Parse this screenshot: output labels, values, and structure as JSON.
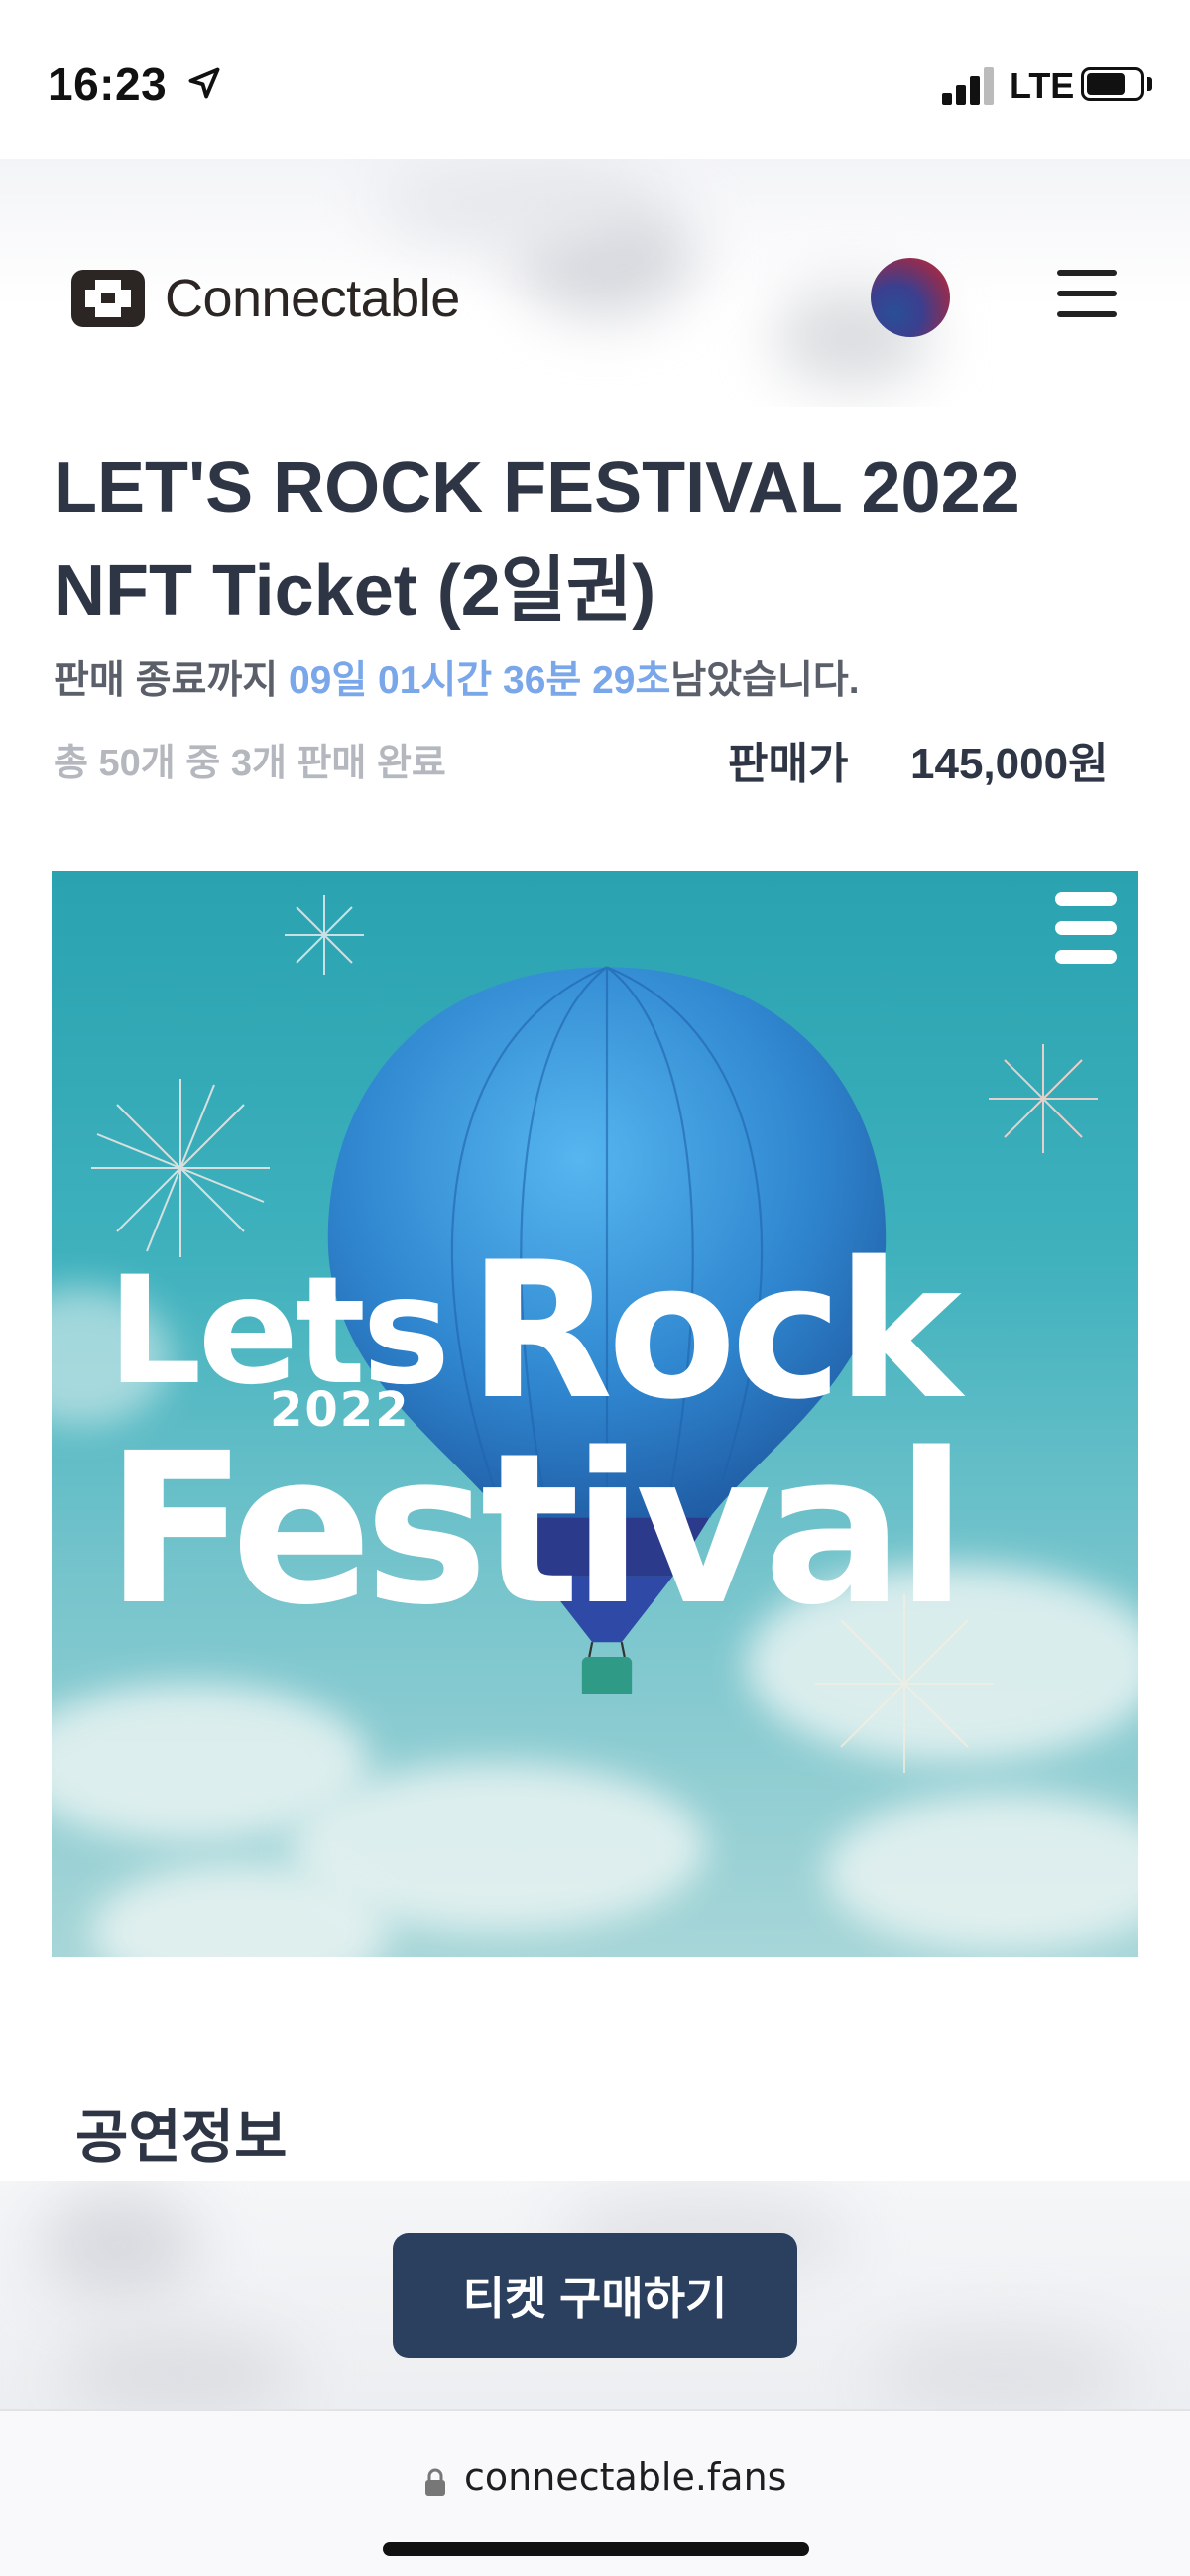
{
  "status_bar": {
    "time": "16:23",
    "network": "LTE",
    "icons": [
      "location-arrow-icon",
      "signal-bars-icon",
      "battery-icon"
    ]
  },
  "header": {
    "logo_text": "Connectable",
    "icons": [
      "connectable-logo-icon",
      "language-globe-icon",
      "hamburger-menu-icon"
    ]
  },
  "product": {
    "title_line1": "LET'S ROCK FESTIVAL 2022",
    "title_line2": "NFT Ticket (2일권)",
    "countdown_prefix": "판매 종료까지 ",
    "countdown_time": "09일 01시간 36분 29초",
    "countdown_suffix": "남았습니다.",
    "sold_info": "총 50개 중 3개 판매 완료",
    "price_label": "판매가",
    "price_value": "145,000원"
  },
  "poster": {
    "line_lets": "Lets",
    "line_rock": "Rock",
    "line_year": "2022",
    "line_festival": "Festival",
    "colors": {
      "sky": "#3eb1bd",
      "balloon": "#3a8fd6",
      "text": "#ffffff"
    }
  },
  "section": {
    "title": "공연정보"
  },
  "cta": {
    "buy_label": "티켓 구매하기",
    "color": "#2b3f5f"
  },
  "browser": {
    "url": "connectable.fans"
  }
}
